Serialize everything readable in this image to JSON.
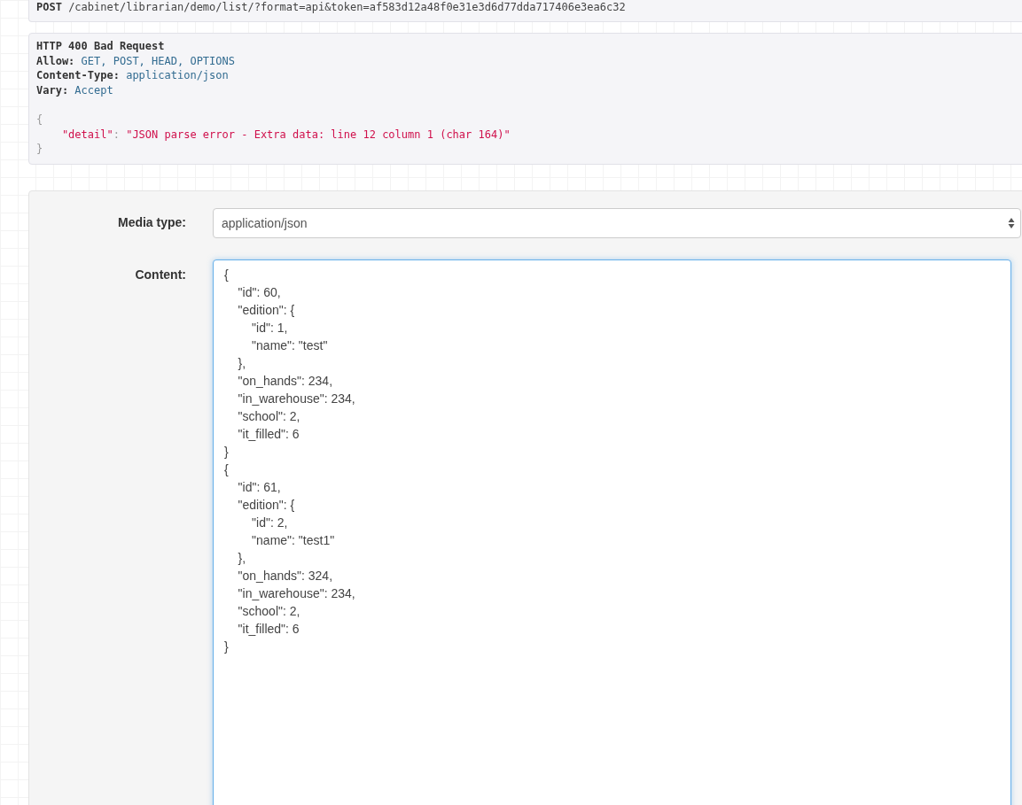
{
  "request": {
    "method": "POST",
    "url": "/cabinet/librarian/demo/list/?format=api&token=af583d12a48f0e31e3d6d77dda717406e3ea6c32"
  },
  "response": {
    "status": "HTTP 400 Bad Request",
    "headers": [
      {
        "name": "Allow:",
        "value": "GET, POST, HEAD, OPTIONS"
      },
      {
        "name": "Content-Type:",
        "value": "application/json"
      },
      {
        "name": "Vary:",
        "value": "Accept"
      }
    ],
    "body": {
      "open": "{",
      "key": "\"detail\"",
      "colon": ":",
      "value": "\"JSON parse error - Extra data: line 12 column 1 (char 164)\"",
      "close": "}"
    }
  },
  "form": {
    "fields": [
      {
        "kind": "select",
        "label": "Media type:",
        "value": "application/json"
      },
      {
        "kind": "textarea",
        "label": "Content:",
        "focused": true,
        "value": "{\n    \"id\": 60,\n    \"edition\": {\n        \"id\": 1,\n        \"name\": \"test\"\n    },\n    \"on_hands\": 234,\n    \"in_warehouse\": 234,\n    \"school\": 2,\n    \"it_filled\": 6\n}\n{\n    \"id\": 61,\n    \"edition\": {\n        \"id\": 2,\n        \"name\": \"test1\"\n    },\n    \"on_hands\": 324,\n    \"in_warehouse\": 234,\n    \"school\": 2,\n    \"it_filled\": 6\n}"
      }
    ]
  }
}
